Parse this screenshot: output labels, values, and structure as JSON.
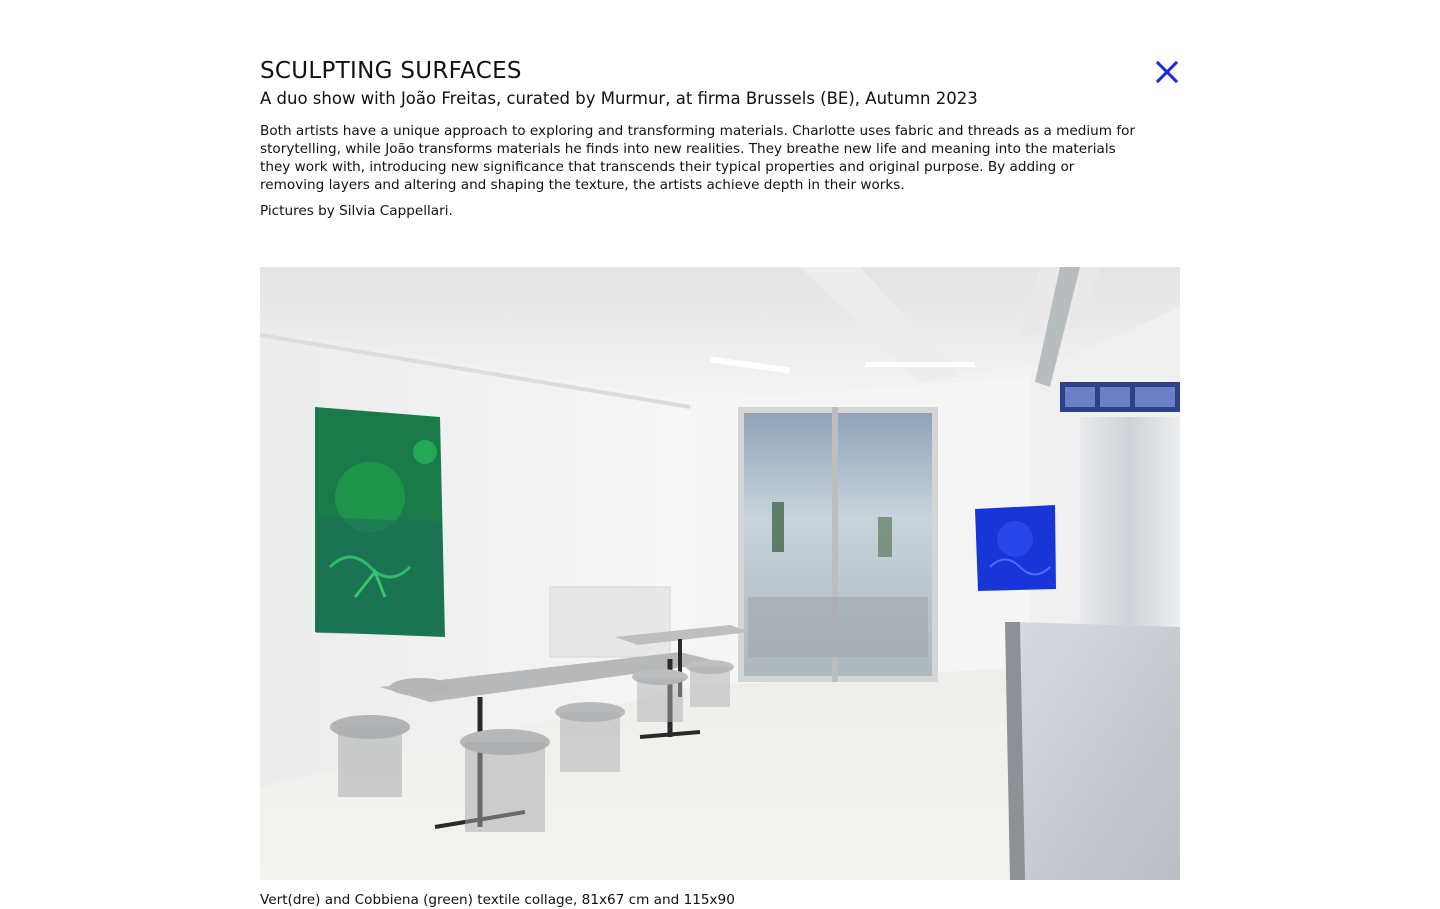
{
  "project": {
    "title": "SCULPTING SURFACES",
    "subtitle": "A duo show with João Freitas, curated by Murmur, at firma Brussels (BE), Autumn 2023",
    "description": "Both artists have a unique approach to exploring and transforming materials. Charlotte uses fabric and threads as a medium for storytelling, while João transforms materials he finds into new realities. They breathe new life and meaning into the materials they work with, introducing new significance that transcends their typical properties and original purpose. By adding or removing layers and altering and shaping the texture, the artists achieve depth in their works.",
    "credits": "Pictures by Silvia Cappellari."
  },
  "close": {
    "icon": "close-icon",
    "color": "#1a2bd6"
  },
  "photo": {
    "subject": "gallery-interior-photo"
  },
  "caption": {
    "text": "Vert(dre) and Cobbiena (green) textile collage, 81x67 cm and 115x90"
  },
  "colors": {
    "accent": "#1a2bd6",
    "text": "#111111",
    "background": "#ffffff"
  }
}
